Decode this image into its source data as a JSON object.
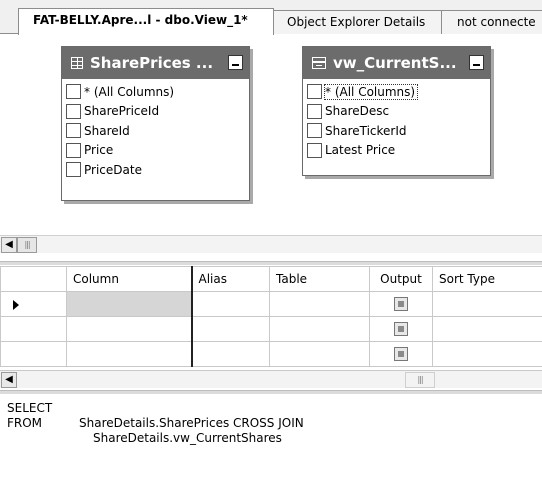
{
  "tabs": [
    {
      "label": "FAT-BELLY.Apre...l - dbo.View_1*",
      "active": true
    },
    {
      "label": "Object Explorer Details",
      "active": false
    },
    {
      "label": "not connecte",
      "active": false
    }
  ],
  "diagram": {
    "tables": [
      {
        "title": "SharePrices ...",
        "icon": "table-icon",
        "columns": [
          "* (All Columns)",
          "SharePriceId",
          "ShareId",
          "Price",
          "PriceDate"
        ]
      },
      {
        "title": "vw_CurrentS...",
        "icon": "view-icon",
        "columns": [
          "* (All Columns)",
          "ShareDesc",
          "ShareTickerId",
          "Latest Price"
        ]
      }
    ]
  },
  "grid": {
    "headers": [
      "Column",
      "Alias",
      "Table",
      "Output",
      "Sort Type"
    ],
    "rows": [
      {
        "column": "",
        "alias": "",
        "table": "",
        "output": true,
        "sort": ""
      },
      {
        "column": "",
        "alias": "",
        "table": "",
        "output": true,
        "sort": ""
      },
      {
        "column": "",
        "alias": "",
        "table": "",
        "output": true,
        "sort": ""
      }
    ]
  },
  "sql": {
    "select_kw": "SELECT",
    "from_kw": "FROM",
    "from_line1": "ShareDetails.SharePrices CROSS JOIN",
    "from_line2": "ShareDetails.vw_CurrentShares"
  },
  "colors": {
    "title_bar": "#6c6c6c",
    "selected_cell": "#d6d6d6"
  }
}
